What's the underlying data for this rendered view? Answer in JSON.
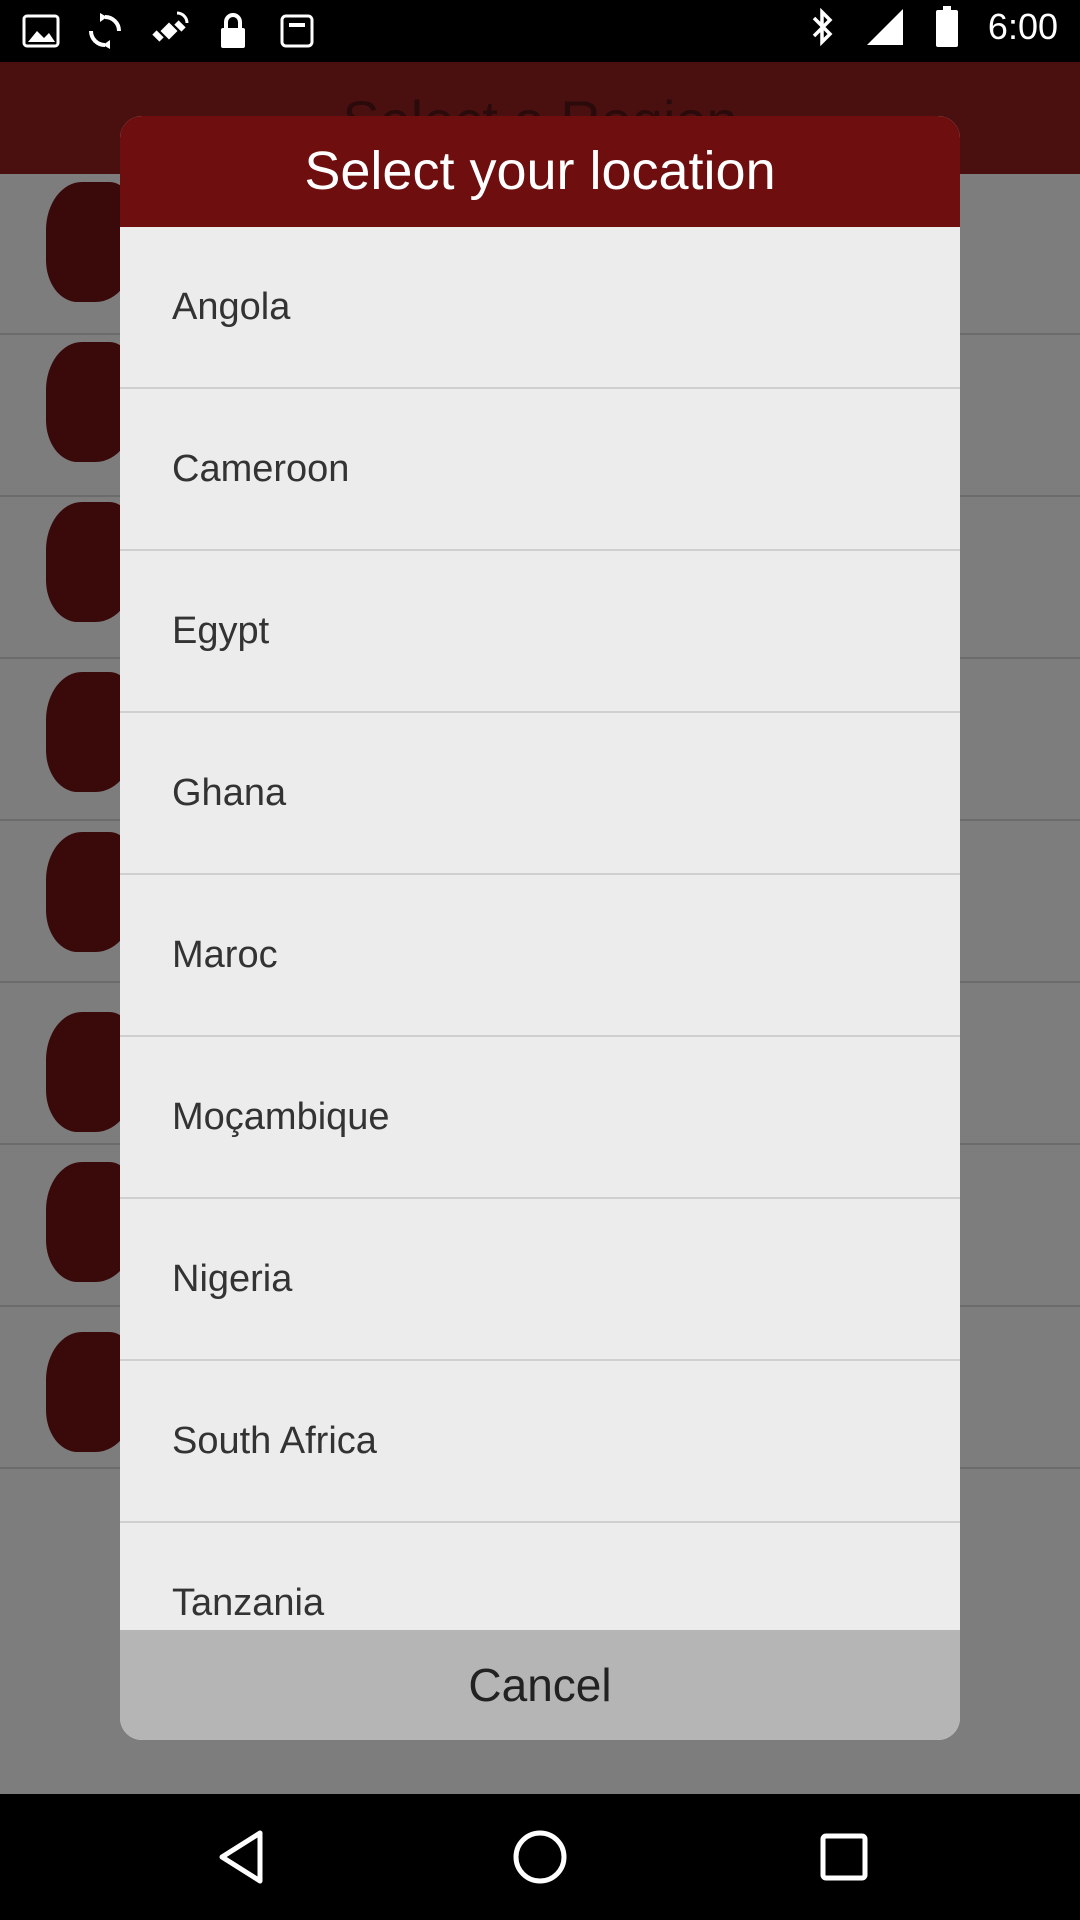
{
  "status_bar": {
    "time": "6:00",
    "left_icons": [
      "image-icon",
      "sync-icon",
      "fake-gps-icon",
      "lock-icon",
      "notification-icon"
    ],
    "right_icons": [
      "bluetooth-icon",
      "signal-icon",
      "battery-icon"
    ]
  },
  "background": {
    "title": "Select a Region"
  },
  "dialog": {
    "title": "Select your location",
    "items": [
      {
        "label": "Angola"
      },
      {
        "label": "Cameroon"
      },
      {
        "label": "Egypt"
      },
      {
        "label": "Ghana"
      },
      {
        "label": "Maroc"
      },
      {
        "label": "Moçambique"
      },
      {
        "label": "Nigeria"
      },
      {
        "label": "South Africa"
      },
      {
        "label": "Tanzania"
      }
    ],
    "cancel_label": "Cancel"
  },
  "colors": {
    "dialog_header": "#6e0e0e",
    "list_background": "#ececec",
    "cancel_background": "#b5b5b5"
  }
}
